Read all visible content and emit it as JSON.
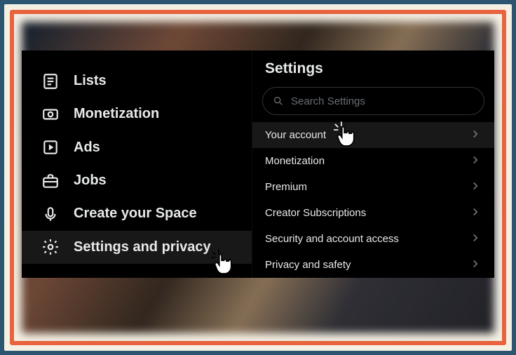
{
  "sidebar": {
    "items": [
      {
        "label": "Lists",
        "icon": "lists-icon"
      },
      {
        "label": "Monetization",
        "icon": "monetization-icon"
      },
      {
        "label": "Ads",
        "icon": "ads-icon"
      },
      {
        "label": "Jobs",
        "icon": "jobs-icon"
      },
      {
        "label": "Create your Space",
        "icon": "space-icon"
      },
      {
        "label": "Settings and privacy",
        "icon": "gear-icon",
        "active": true
      }
    ]
  },
  "panel": {
    "title": "Settings",
    "search_placeholder": "Search Settings",
    "rows": [
      {
        "label": "Your account",
        "highlight": true
      },
      {
        "label": "Monetization"
      },
      {
        "label": "Premium"
      },
      {
        "label": "Creator Subscriptions"
      },
      {
        "label": "Security and account access"
      },
      {
        "label": "Privacy and safety"
      }
    ]
  }
}
